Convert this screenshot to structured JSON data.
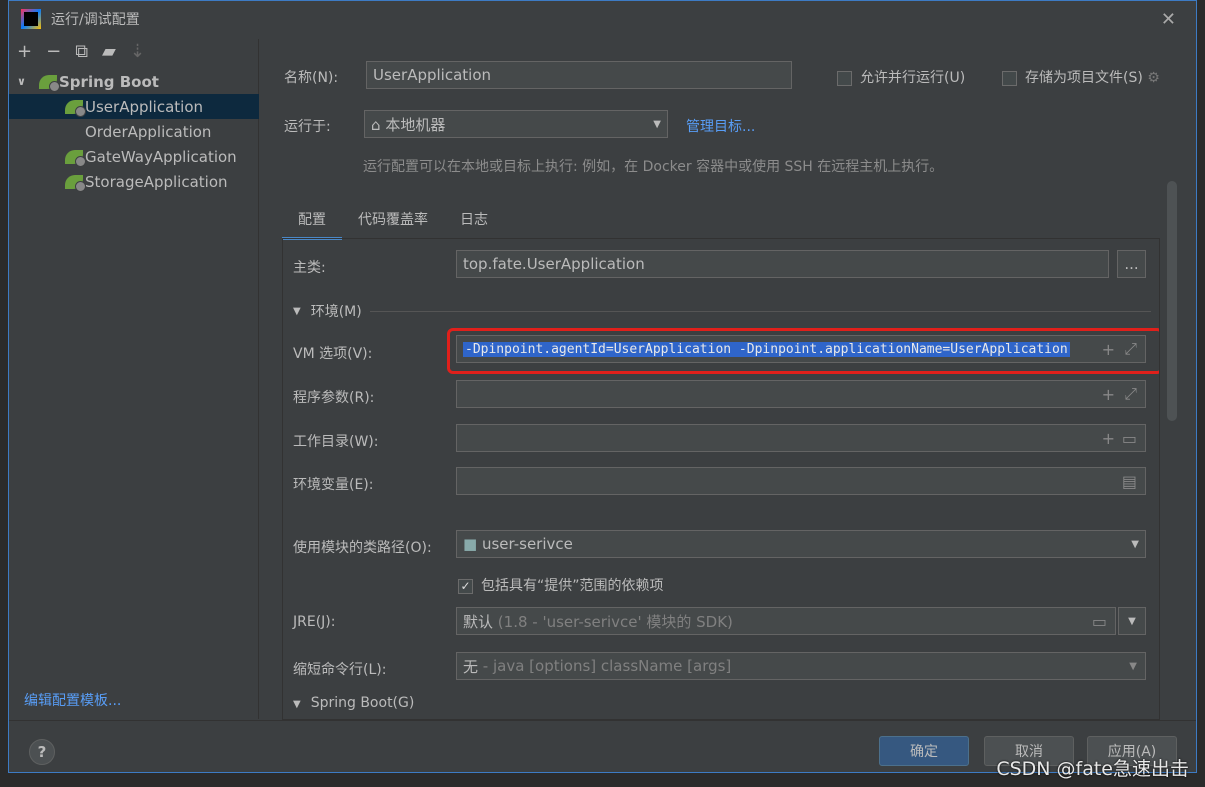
{
  "window": {
    "title": "运行/调试配置"
  },
  "toolbar": {
    "icons": [
      "plus-icon",
      "minus-icon",
      "copy-icon",
      "new-folder-icon",
      "sort-icon"
    ]
  },
  "tree": {
    "group": "Spring Boot",
    "items": [
      {
        "label": "UserApplication",
        "selected": true,
        "icon": true
      },
      {
        "label": "OrderApplication",
        "selected": false,
        "icon": false
      },
      {
        "label": "GateWayApplication",
        "selected": false,
        "icon": true
      },
      {
        "label": "StorageApplication",
        "selected": false,
        "icon": true
      }
    ]
  },
  "edit_templates": "编辑配置模板...",
  "form": {
    "name_label": "名称(N):",
    "name_value": "UserApplication",
    "parallel_label": "允许并行运行(U)",
    "store_label": "存储为项目文件(S)",
    "run_on_label": "运行于:",
    "run_on_value": "本地机器",
    "manage_targets": "管理目标...",
    "hint": "运行配置可以在本地或目标上执行: 例如，在 Docker 容器中或使用 SSH 在远程主机上执行。"
  },
  "tabs": [
    "配置",
    "代码覆盖率",
    "日志"
  ],
  "config": {
    "main_class_label": "主类:",
    "main_class_value": "top.fate.UserApplication",
    "browse": "...",
    "env_section": "环境(M)",
    "vm_label": "VM 选项(V):",
    "vm_value": "-Dpinpoint.agentId=UserApplication -Dpinpoint.applicationName=UserApplication",
    "args_label": "程序参数(R):",
    "workdir_label": "工作目录(W):",
    "envvars_label": "环境变量(E):",
    "module_label": "使用模块的类路径(O):",
    "module_value": "user-serivce",
    "include_provided": "包括具有“提供”范围的依赖项",
    "jre_label": "JRE(J):",
    "jre_value_main": "默认",
    "jre_value_sub": "(1.8 - 'user-serivce' 模块的 SDK)",
    "shorten_label": "缩短命令行(L):",
    "shorten_value_main": "无",
    "shorten_value_sub": "- java [options] className [args]",
    "springboot_section": "Spring Boot(G)"
  },
  "buttons": {
    "ok": "确定",
    "cancel": "取消",
    "apply": "应用(A)",
    "help": "?"
  },
  "highlight_color": "#e0201b",
  "watermark": "CSDN @fate急速出击"
}
